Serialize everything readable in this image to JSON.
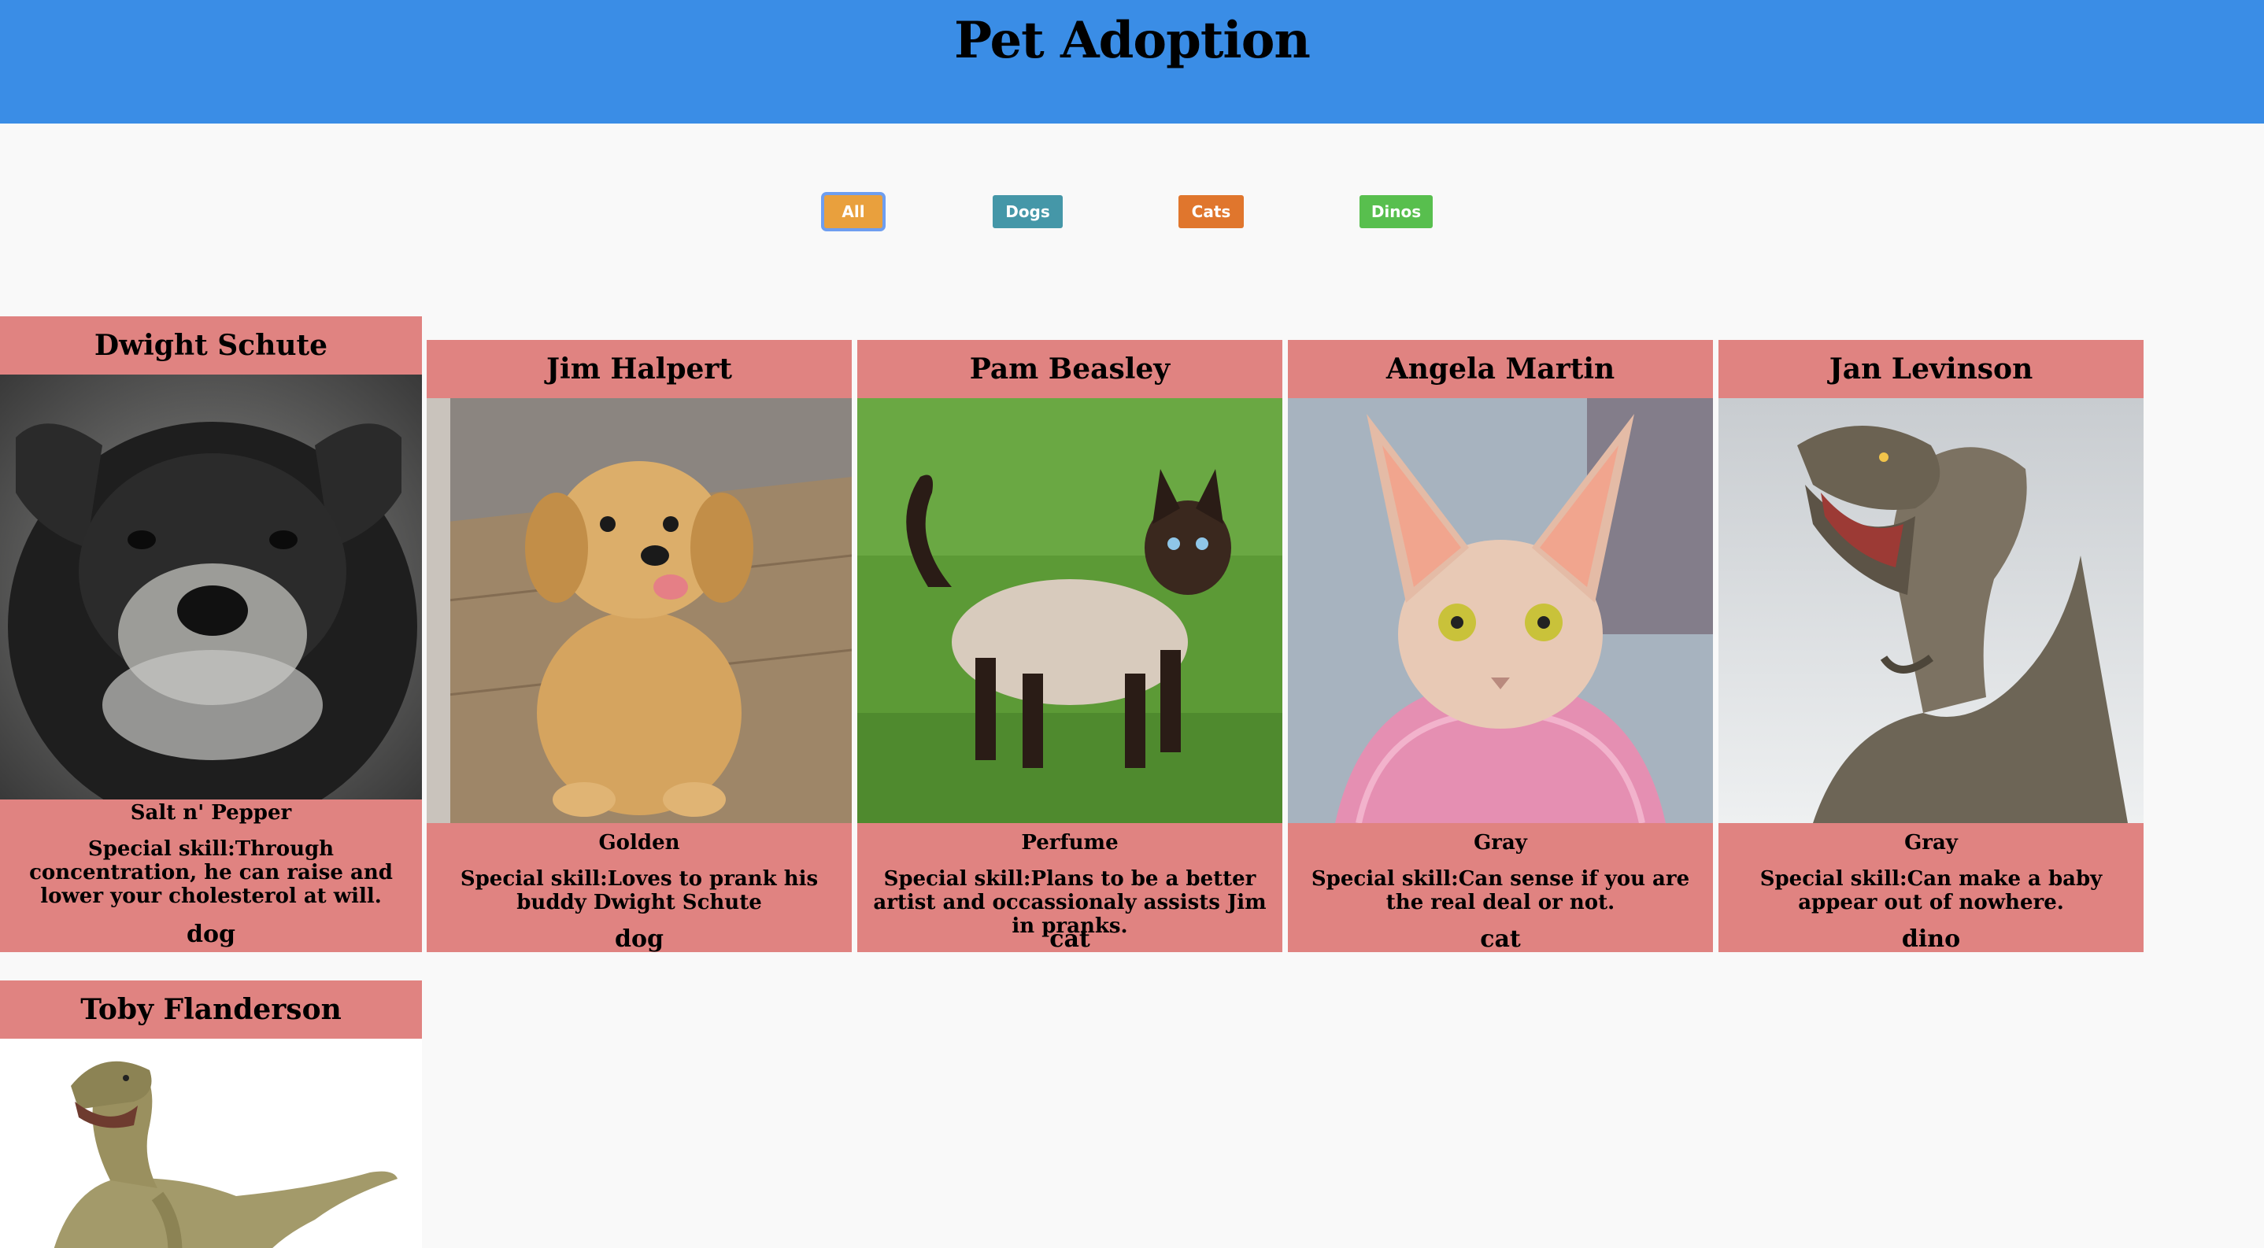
{
  "header": {
    "title": "Pet Adoption"
  },
  "filters": [
    {
      "label": "All",
      "color": "#e9a03d",
      "active": true
    },
    {
      "label": "Dogs",
      "color": "#4597a8"
    },
    {
      "label": "Cats",
      "color": "#e0762d"
    },
    {
      "label": "Dinos",
      "color": "#58bf4e"
    }
  ],
  "cards": [
    {
      "name": "Dwight Schute",
      "color": "Salt n' Pepper",
      "skill": "Special skill:Through concentration, he can raise and lower your cholesterol at will.",
      "type": "dog",
      "image": "schnauzer-puppy-image"
    },
    {
      "name": "Jim Halpert",
      "color": "Golden",
      "skill": "Special skill:Loves to prank his buddy Dwight Schute",
      "type": "dog",
      "image": "golden-retriever-puppy-image"
    },
    {
      "name": "Pam Beasley",
      "color": "Perfume",
      "skill": "Special skill:Plans to be a better artist and occassionaly assists Jim in pranks.",
      "type": "cat",
      "image": "siamese-cat-image"
    },
    {
      "name": "Angela Martin",
      "color": "Gray",
      "skill": "Special skill:Can sense if you are the real deal or not.",
      "type": "cat",
      "image": "sphynx-cat-image"
    },
    {
      "name": "Jan Levinson",
      "color": "Gray",
      "skill": "Special skill:Can make a baby appear out of nowhere.",
      "type": "dino",
      "image": "t-rex-image"
    },
    {
      "name": "Toby Flanderson",
      "image": "raptor-image"
    }
  ],
  "colors": {
    "header": "#3a8de6",
    "card": "#e08381",
    "background": "#f9f9f9"
  }
}
